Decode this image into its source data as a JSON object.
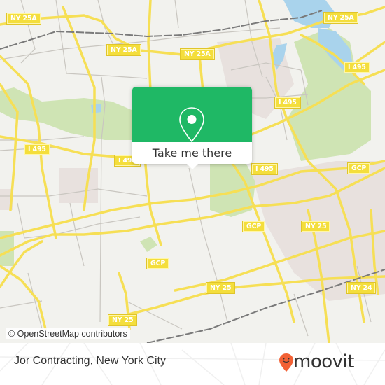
{
  "map": {
    "colors": {
      "background": "#f2f2ee",
      "road_major": "#f6df55",
      "road_minor": "#c9c6c0",
      "park": "#cfe4b4",
      "water": "#a9d3ec",
      "urban": "#e8e1de",
      "rail": "#7a7a7a"
    },
    "road_labels": [
      {
        "id": "ny25a-1",
        "text": "NY 25A"
      },
      {
        "id": "ny25a-2",
        "text": "NY 25A"
      },
      {
        "id": "ny25a-3",
        "text": "NY 25A"
      },
      {
        "id": "ny25a-4",
        "text": "NY 25A"
      },
      {
        "id": "i495-1",
        "text": "I 495"
      },
      {
        "id": "i495-2",
        "text": "I 495"
      },
      {
        "id": "i495-3",
        "text": "I 495"
      },
      {
        "id": "i495-4",
        "text": "I 495"
      },
      {
        "id": "i495-5",
        "text": "I 495"
      },
      {
        "id": "gcp-1",
        "text": "GCP"
      },
      {
        "id": "gcp-2",
        "text": "GCP"
      },
      {
        "id": "gcp-3",
        "text": "GCP"
      },
      {
        "id": "ny25-1",
        "text": "NY 25"
      },
      {
        "id": "ny25-2",
        "text": "NY 25"
      },
      {
        "id": "ny25-3",
        "text": "NY 25"
      },
      {
        "id": "ny24-1",
        "text": "NY 24"
      }
    ],
    "attribution": "© OpenStreetMap contributors"
  },
  "popup": {
    "icon": "map-pin-icon",
    "button_label": "Take me there",
    "accent_color": "#1fb865"
  },
  "footer": {
    "place_name": "Jor Contracting, New York City",
    "brand": {
      "name": "moovit",
      "icon": "moovit-pin-logo-icon",
      "color": "#f26135"
    }
  }
}
